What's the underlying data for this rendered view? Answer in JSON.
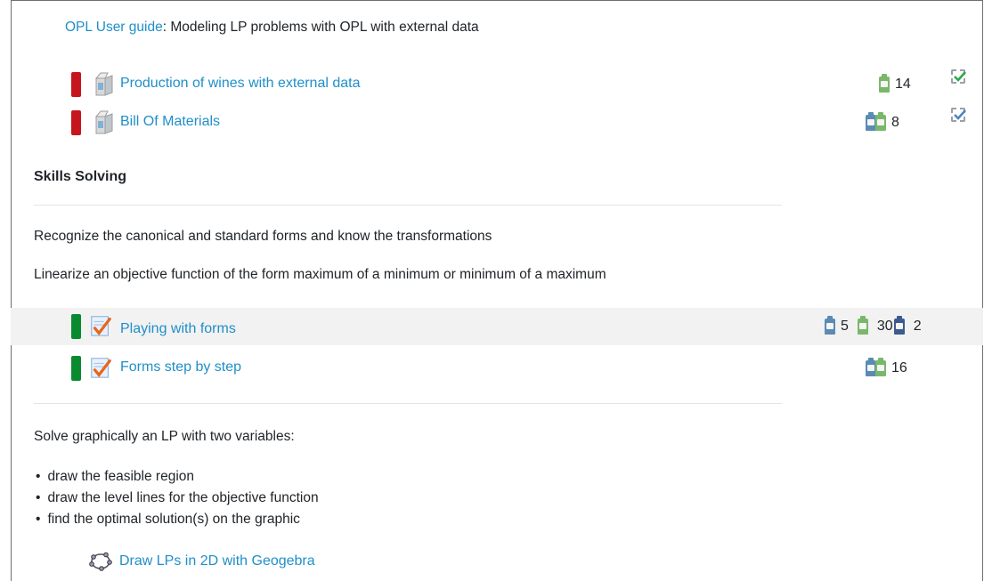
{
  "guide": {
    "link": "OPL User guide",
    "text": ": Modeling LP problems with OPL with external data"
  },
  "activities_opl": [
    {
      "title": "Production of wines with external data",
      "count": "14",
      "status": "green"
    },
    {
      "title": "Bill Of Materials",
      "count": "8",
      "status": "blue"
    }
  ],
  "skills": {
    "heading": "Skills Solving",
    "line1": "Recognize the canonical and standard forms and know the transformations",
    "line2": "Linearize an objective function of the form maximum of a minimum or minimum of a maximum"
  },
  "activities_forms": [
    {
      "title": "Playing with forms",
      "counts": [
        "5",
        "30",
        "2"
      ]
    },
    {
      "title": "Forms step by step",
      "count": "16"
    }
  ],
  "graphic": {
    "intro": "Solve graphically an LP with two variables:",
    "items": [
      "draw the feasible region",
      "draw the level lines for the objective function",
      "find the optimal solution(s) on the graphic"
    ],
    "link": "Draw LPs in 2D with Geogebra"
  },
  "colors": {
    "link": "#1f8fc9",
    "bar_red": "#c4161c",
    "bar_green": "#0a8a2f",
    "row_highlight": "#f2f2f2"
  }
}
